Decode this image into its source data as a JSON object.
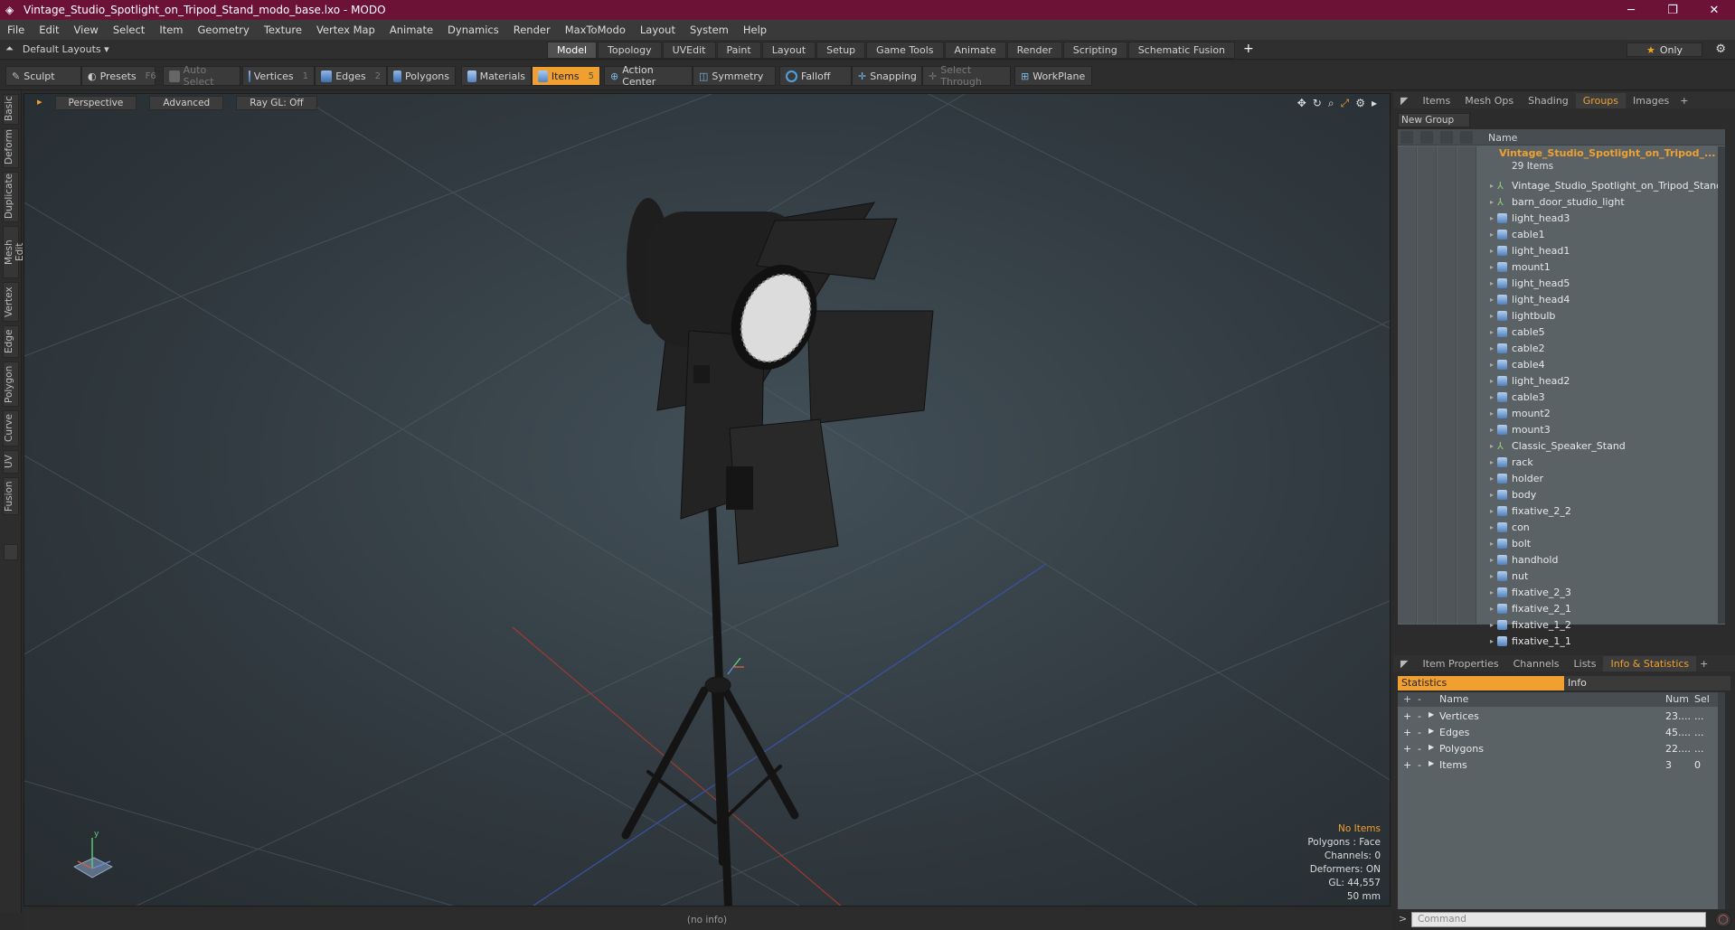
{
  "window": {
    "title": "Vintage_Studio_Spotlight_on_Tripod_Stand_modo_base.lxo - MODO",
    "minimize": "─",
    "maximize": "❐",
    "close": "✕"
  },
  "menu": [
    "File",
    "Edit",
    "View",
    "Select",
    "Item",
    "Geometry",
    "Texture",
    "Vertex Map",
    "Animate",
    "Dynamics",
    "Render",
    "MaxToModo",
    "Layout",
    "System",
    "Help"
  ],
  "layout": {
    "layouts_label": "Default Layouts",
    "tabs": [
      "Model",
      "Topology",
      "UVEdit",
      "Paint",
      "Layout",
      "Setup",
      "Game Tools",
      "Animate",
      "Render",
      "Scripting",
      "Schematic Fusion"
    ],
    "active_tab": "Model",
    "only_label": "Only"
  },
  "toolbar": {
    "sculpt": "Sculpt",
    "presets": "Presets",
    "presets_key": "F6",
    "auto_select": "Auto Select",
    "vertices": "Vertices",
    "vertices_key": "1",
    "edges": "Edges",
    "edges_key": "2",
    "polygons": "Polygons",
    "materials": "Materials",
    "items": "Items",
    "items_key": "5",
    "action_center": "Action Center",
    "symmetry": "Symmetry",
    "falloff": "Falloff",
    "snapping": "Snapping",
    "select_through": "Select Through",
    "workplane": "WorkPlane"
  },
  "left_tabs": [
    "Basic",
    "Deform",
    "Duplicate",
    "Mesh Edit",
    "Vertex",
    "Edge",
    "Polygon",
    "Curve",
    "UV",
    "Fusion"
  ],
  "viewport": {
    "view": "Perspective",
    "shading": "Advanced",
    "raygl": "Ray GL: Off",
    "stats": {
      "items": "No Items",
      "polygons": "Polygons : Face",
      "channels": "Channels: 0",
      "deformers": "Deformers: ON",
      "gl": "GL: 44,557",
      "lens": "50 mm"
    }
  },
  "status_bar": "(no info)",
  "right_panel": {
    "top_tabs": [
      "Items",
      "Mesh Ops",
      "Shading",
      "Groups",
      "Images"
    ],
    "active_top_tab": "Groups",
    "new_group": "New Group",
    "name_column": "Name",
    "group_name": "Vintage_Studio_Spotlight_on_Tripod_...",
    "group_count": "29 Items",
    "items": [
      {
        "name": "Vintage_Studio_Spotlight_on_Tripod_Stand",
        "type": "locator"
      },
      {
        "name": "barn_door_studio_light",
        "type": "locator"
      },
      {
        "name": "light_head3",
        "type": "mesh"
      },
      {
        "name": "cable1",
        "type": "mesh"
      },
      {
        "name": "light_head1",
        "type": "mesh"
      },
      {
        "name": "mount1",
        "type": "mesh"
      },
      {
        "name": "light_head5",
        "type": "mesh"
      },
      {
        "name": "light_head4",
        "type": "mesh"
      },
      {
        "name": "lightbulb",
        "type": "mesh"
      },
      {
        "name": "cable5",
        "type": "mesh"
      },
      {
        "name": "cable2",
        "type": "mesh"
      },
      {
        "name": "cable4",
        "type": "mesh"
      },
      {
        "name": "light_head2",
        "type": "mesh"
      },
      {
        "name": "cable3",
        "type": "mesh"
      },
      {
        "name": "mount2",
        "type": "mesh"
      },
      {
        "name": "mount3",
        "type": "mesh"
      },
      {
        "name": "Classic_Speaker_Stand",
        "type": "locator"
      },
      {
        "name": "rack",
        "type": "mesh"
      },
      {
        "name": "holder",
        "type": "mesh"
      },
      {
        "name": "body",
        "type": "mesh"
      },
      {
        "name": "fixative_2_2",
        "type": "mesh"
      },
      {
        "name": "con",
        "type": "mesh"
      },
      {
        "name": "bolt",
        "type": "mesh"
      },
      {
        "name": "handhold",
        "type": "mesh"
      },
      {
        "name": "nut",
        "type": "mesh"
      },
      {
        "name": "fixative_2_3",
        "type": "mesh"
      },
      {
        "name": "fixative_2_1",
        "type": "mesh"
      },
      {
        "name": "fixative_1_2",
        "type": "mesh"
      },
      {
        "name": "fixative_1_1",
        "type": "mesh"
      }
    ],
    "bottom_tabs": [
      "Item Properties",
      "Channels",
      "Lists",
      "Info & Statistics"
    ],
    "active_bottom_tab": "Info & Statistics",
    "stats_tab": "Statistics",
    "info_tab": "Info",
    "stats_header": {
      "name": "Name",
      "num": "Num",
      "sel": "Sel"
    },
    "stats_rows": [
      {
        "name": "Vertices",
        "num": "23....",
        "sel": "..."
      },
      {
        "name": "Edges",
        "num": "45....",
        "sel": "..."
      },
      {
        "name": "Polygons",
        "num": "22....",
        "sel": "..."
      },
      {
        "name": "Items",
        "num": "3",
        "sel": "0"
      }
    ],
    "command_placeholder": "Command"
  }
}
